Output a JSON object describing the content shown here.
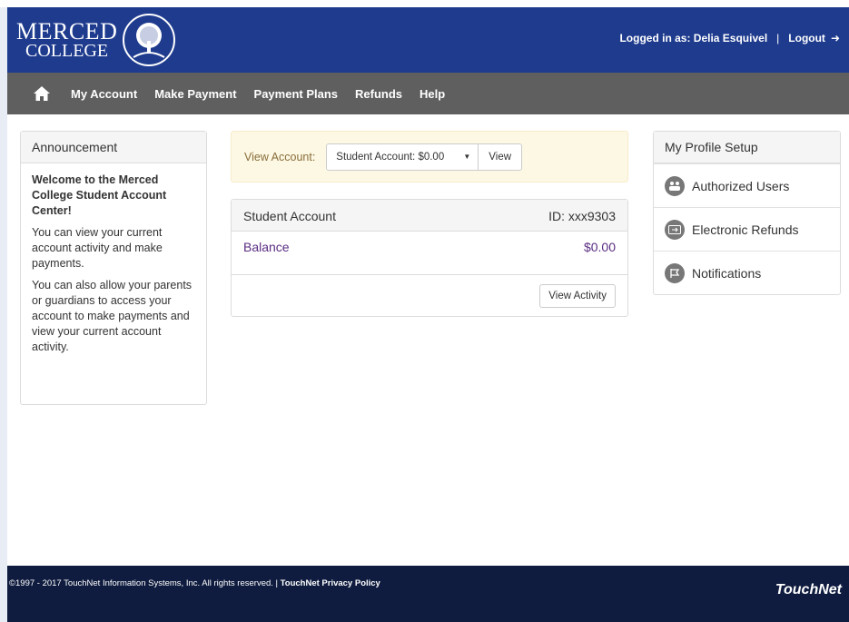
{
  "header": {
    "logo_line1": "MERCED",
    "logo_line2": "COLLEGE",
    "logged_in_label": "Logged in as: Delia Esquivel",
    "separator": "|",
    "logout_label": "Logout",
    "bg_color": "#1e3b8e"
  },
  "nav": {
    "home_icon": "home-icon",
    "items": [
      {
        "label": "My Account"
      },
      {
        "label": "Make Payment"
      },
      {
        "label": "Payment Plans"
      },
      {
        "label": "Refunds"
      },
      {
        "label": "Help"
      }
    ]
  },
  "announcement": {
    "title": "Announcement",
    "welcome": "Welcome to the Merced College Student Account Center!",
    "para1": "You can view your current account activity and make payments.",
    "para2": "You can also allow your parents or guardians to access your account to make payments and view your current account activity."
  },
  "view_account": {
    "label": "View Account:",
    "selected": "Student Account: $0.00",
    "button": "View"
  },
  "student_account": {
    "title": "Student Account",
    "id": "ID: xxx9303",
    "balance_label": "Balance",
    "balance_value": "$0.00",
    "view_activity": "View Activity"
  },
  "profile": {
    "title": "My Profile Setup",
    "items": [
      {
        "label": "Authorized Users",
        "icon": "users-icon"
      },
      {
        "label": "Electronic Refunds",
        "icon": "refund-icon"
      },
      {
        "label": "Notifications",
        "icon": "notification-icon"
      }
    ]
  },
  "footer": {
    "copyright": "©1997 - 2017 TouchNet Information Systems, Inc. All rights reserved. |",
    "privacy": "TouchNet Privacy Policy",
    "brand": "TouchNet"
  }
}
